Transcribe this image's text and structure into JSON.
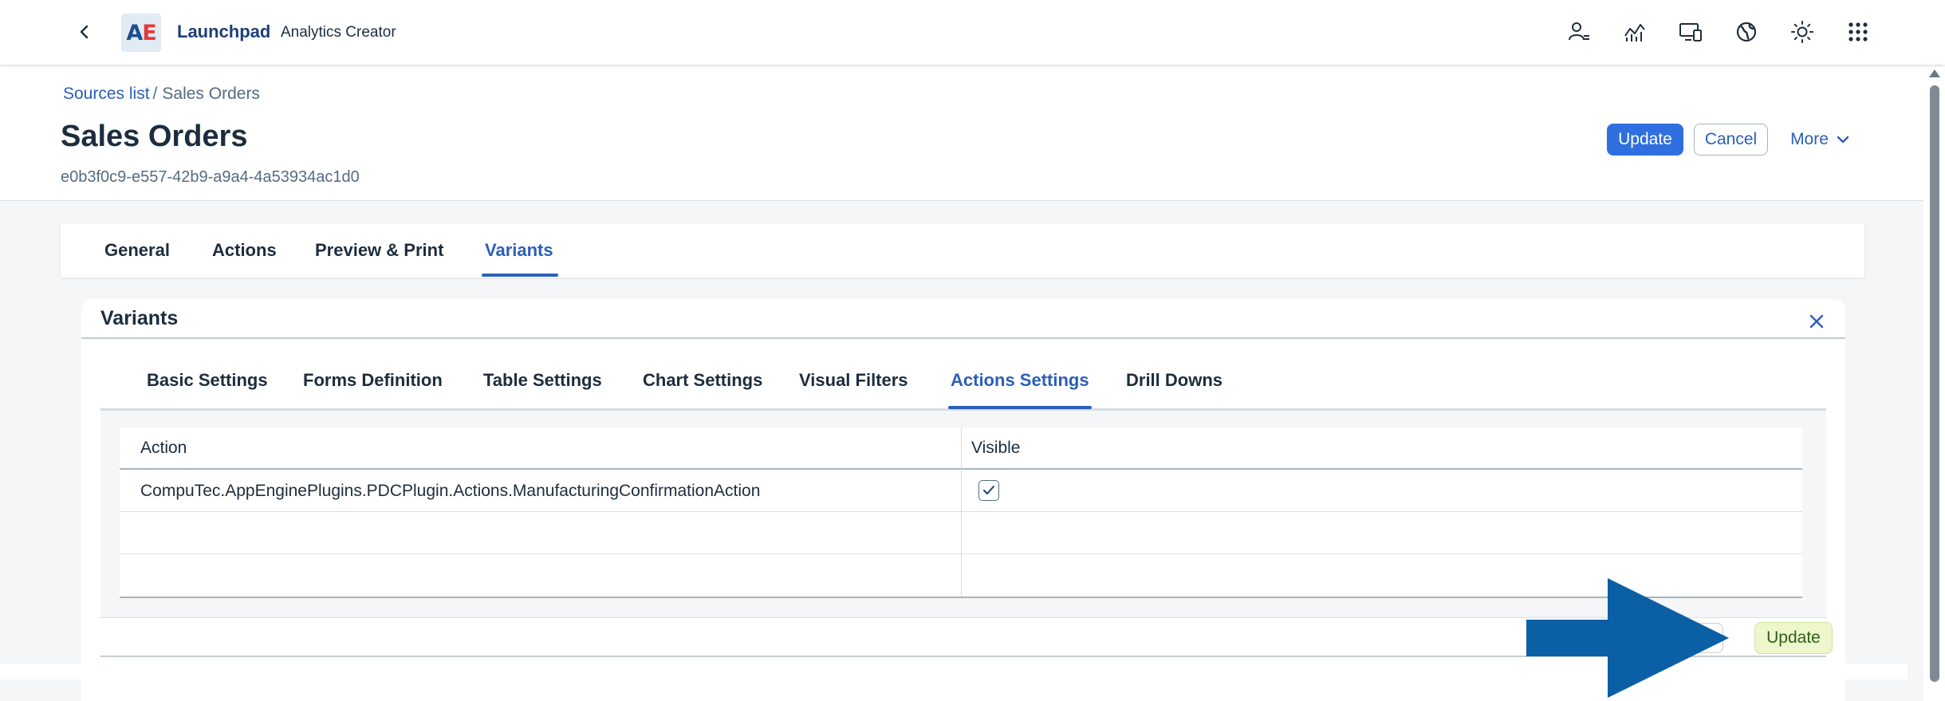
{
  "shell": {
    "logo_a": "A",
    "logo_e": "E",
    "title": "Launchpad",
    "subtitle": "Analytics Creator",
    "icons": [
      "back-icon",
      "user-settings-icon",
      "analytics-icon",
      "devices-icon",
      "globe-icon",
      "theme-icon",
      "app-grid-icon"
    ]
  },
  "header": {
    "breadcrumb_link": "Sources list",
    "breadcrumb_sep": "/",
    "breadcrumb_current": "Sales Orders",
    "title": "Sales Orders",
    "subtitle": "e0b3f0c9-e557-42b9-a9a4-4a53934ac1d0",
    "update_label": "Update",
    "cancel_label": "Cancel",
    "more_label": "More"
  },
  "section_tabs": [
    {
      "label": "General",
      "active": false
    },
    {
      "label": "Actions",
      "active": false
    },
    {
      "label": "Preview & Print",
      "active": false
    },
    {
      "label": "Variants",
      "active": true
    }
  ],
  "variants": {
    "title": "Variants",
    "sub_tabs": [
      {
        "label": "Basic Settings",
        "active": false
      },
      {
        "label": "Forms Definition",
        "active": false
      },
      {
        "label": "Table Settings",
        "active": false
      },
      {
        "label": "Chart Settings",
        "active": false
      },
      {
        "label": "Visual Filters",
        "active": false
      },
      {
        "label": "Actions Settings",
        "active": true
      },
      {
        "label": "Drill Downs",
        "active": false
      }
    ],
    "table": {
      "columns": [
        "Action",
        "Visible"
      ],
      "rows": [
        {
          "action": "CompuTec.AppEnginePlugins.PDCPlugin.Actions.ManufacturingConfirmationAction",
          "visible": true
        },
        {
          "action": "",
          "visible": null
        },
        {
          "action": "",
          "visible": null
        }
      ]
    },
    "footer_update_label": "Update"
  },
  "colors": {
    "brand_blue": "#2b5fb8",
    "emphasized_button": "#2f6fe0",
    "footer_update_bg": "#eef6cc",
    "annotation_arrow": "#0b5fa5"
  }
}
